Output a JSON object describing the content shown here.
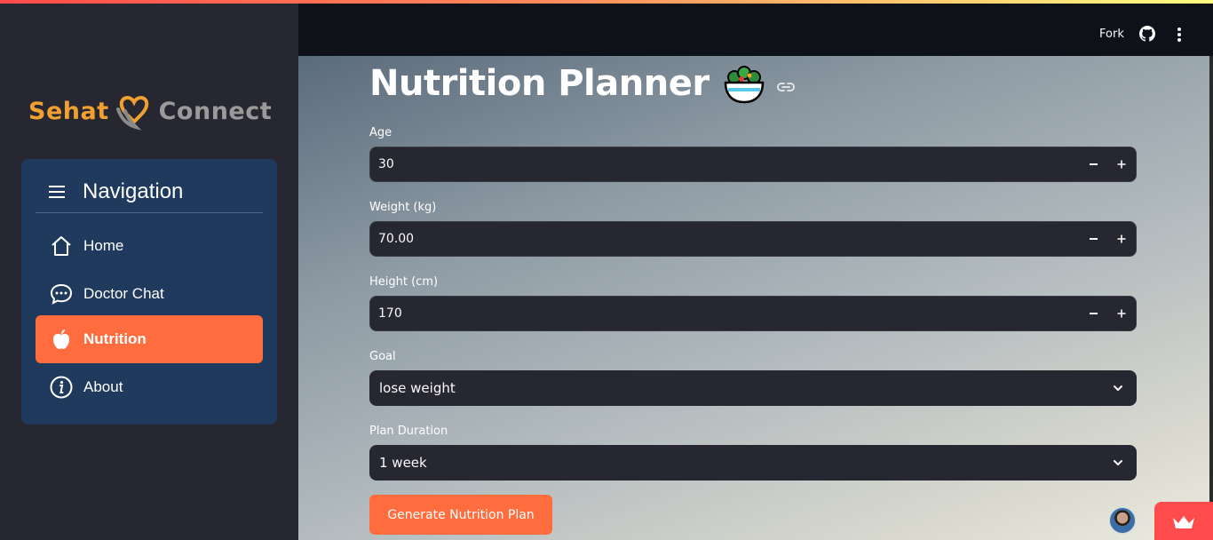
{
  "app": {
    "logo_text_left": "Sehat",
    "logo_text_right": "Connect",
    "brand_orange": "#f0a030",
    "accent": "#ff6c3e"
  },
  "header": {
    "fork_label": "Fork",
    "github_icon": "github-icon",
    "menu_icon": "kebab-menu-icon"
  },
  "sidebar": {
    "nav_title": "Navigation",
    "items": [
      {
        "label": "Home",
        "icon": "home-icon",
        "active": false
      },
      {
        "label": "Doctor Chat",
        "icon": "chat-icon",
        "active": false
      },
      {
        "label": "Nutrition",
        "icon": "apple-icon",
        "active": true
      },
      {
        "label": "About",
        "icon": "info-icon",
        "active": false
      }
    ]
  },
  "main": {
    "title": "Nutrition Planner",
    "title_emoji_icon": "salad-icon",
    "fields": {
      "age": {
        "label": "Age",
        "value": "30"
      },
      "weight": {
        "label": "Weight (kg)",
        "value": "70.00"
      },
      "height": {
        "label": "Height (cm)",
        "value": "170"
      },
      "goal": {
        "label": "Goal",
        "value": "lose weight"
      },
      "duration": {
        "label": "Plan Duration",
        "value": "1 week"
      }
    },
    "generate_button": "Generate Nutrition Plan"
  }
}
